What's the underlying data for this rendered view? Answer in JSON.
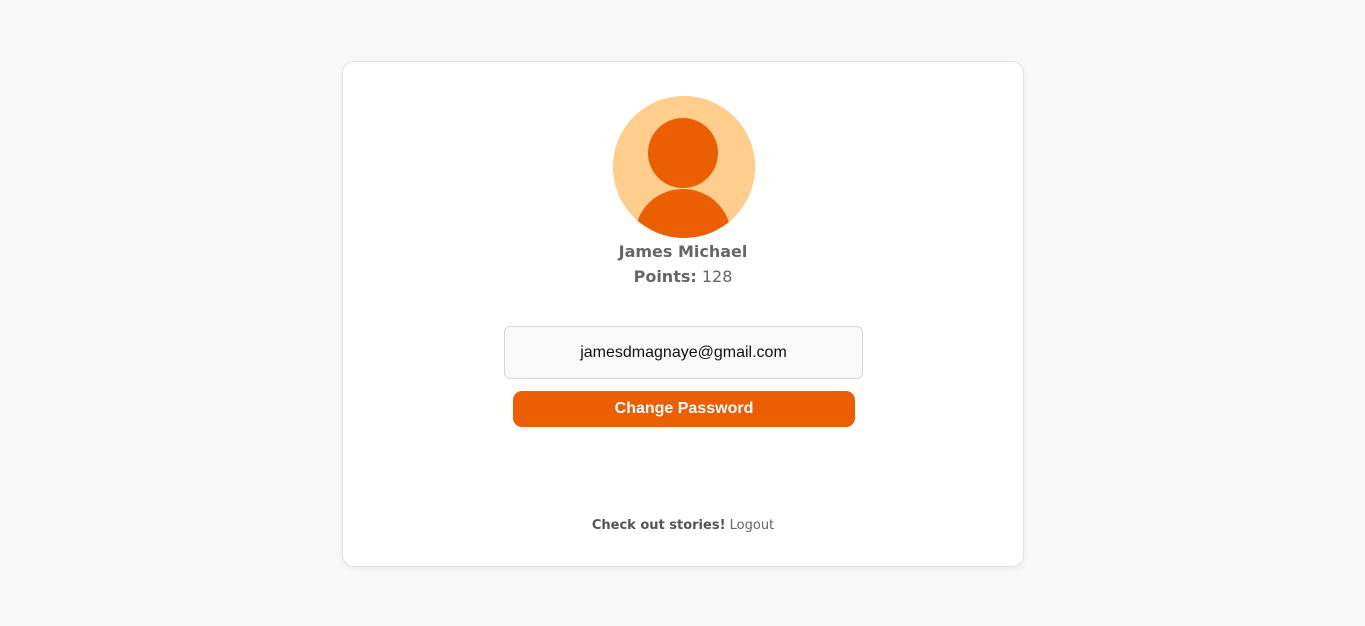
{
  "profile": {
    "name": "James Michael",
    "points_label": "Points:",
    "points_value": "128",
    "email": "jamesdmagnaye@gmail.com",
    "avatar_icon": "user-avatar-icon"
  },
  "actions": {
    "change_password_label": "Change Password"
  },
  "footer": {
    "stories_text": "Check out stories!",
    "logout_label": "Logout"
  },
  "colors": {
    "accent": "#ec5e02",
    "avatar_bg": "#ffcd8c",
    "page_bg": "#f8f8f8"
  }
}
